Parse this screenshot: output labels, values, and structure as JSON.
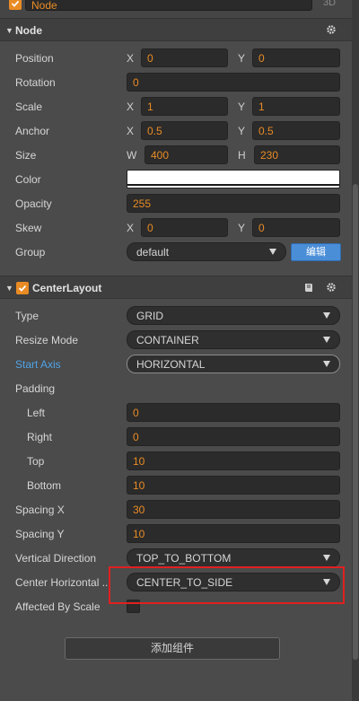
{
  "node_header": {
    "name": "Node",
    "tag": "3D"
  },
  "node_section": {
    "title": "Node",
    "position": {
      "label": "Position",
      "x_label": "X",
      "x": "0",
      "y_label": "Y",
      "y": "0"
    },
    "rotation": {
      "label": "Rotation",
      "value": "0"
    },
    "scale": {
      "label": "Scale",
      "x_label": "X",
      "x": "1",
      "y_label": "Y",
      "y": "1"
    },
    "anchor": {
      "label": "Anchor",
      "x_label": "X",
      "x": "0.5",
      "y_label": "Y",
      "y": "0.5"
    },
    "size": {
      "label": "Size",
      "w_label": "W",
      "w": "400",
      "h_label": "H",
      "h": "230"
    },
    "color": {
      "label": "Color",
      "value": "#ffffff"
    },
    "opacity": {
      "label": "Opacity",
      "value": "255"
    },
    "skew": {
      "label": "Skew",
      "x_label": "X",
      "x": "0",
      "y_label": "Y",
      "y": "0"
    },
    "group": {
      "label": "Group",
      "value": "default",
      "edit_label": "编辑"
    }
  },
  "center_layout": {
    "title": "CenterLayout",
    "type": {
      "label": "Type",
      "value": "GRID"
    },
    "resize_mode": {
      "label": "Resize Mode",
      "value": "CONTAINER"
    },
    "start_axis": {
      "label": "Start Axis",
      "value": "HORIZONTAL"
    },
    "padding": {
      "label": "Padding"
    },
    "left": {
      "label": "Left",
      "value": "0"
    },
    "right": {
      "label": "Right",
      "value": "0"
    },
    "top": {
      "label": "Top",
      "value": "10"
    },
    "bottom": {
      "label": "Bottom",
      "value": "10"
    },
    "spacing_x": {
      "label": "Spacing X",
      "value": "30"
    },
    "spacing_y": {
      "label": "Spacing Y",
      "value": "10"
    },
    "vertical_direction": {
      "label": "Vertical Direction",
      "value": "TOP_TO_BOTTOM"
    },
    "center_horizontal": {
      "label": "Center Horizontal ...",
      "value": "CENTER_TO_SIDE"
    },
    "affected_by_scale": {
      "label": "Affected By Scale",
      "checked": false
    }
  },
  "add_component": {
    "label": "添加组件"
  },
  "colors": {
    "accent": "#e98b24",
    "button_blue": "#4b8ed8",
    "label_blue": "#4ea3e8",
    "highlight": "#e02020"
  }
}
